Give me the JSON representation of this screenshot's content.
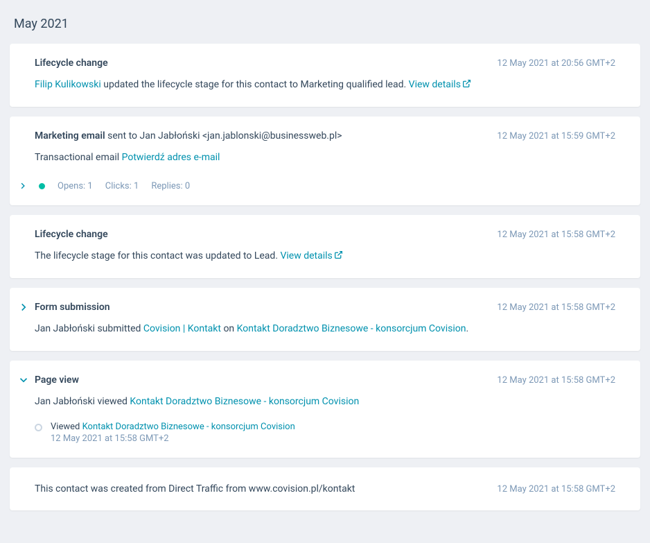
{
  "month_label": "May 2021",
  "cards": [
    {
      "title": "Lifecycle change",
      "timestamp": "12 May 2021 at 20:56 GMT+2",
      "actor": "Filip Kulikowski",
      "body_after_actor": " updated the lifecycle stage for this contact to Marketing qualified lead. ",
      "view_details": "View details"
    },
    {
      "title_strong": "Marketing email",
      "title_rest": " sent to Jan Jabłoński <jan.jablonski@businessweb.pl>",
      "timestamp": "12 May 2021 at 15:59 GMT+2",
      "body_prefix": "Transactional email ",
      "email_link": "Potwierdź adres e-mail",
      "opens_label": "Opens:",
      "opens_value": "1",
      "clicks_label": "Clicks:",
      "clicks_value": "1",
      "replies_label": "Replies:",
      "replies_value": "0"
    },
    {
      "title": "Lifecycle change",
      "timestamp": "12 May 2021 at 15:58 GMT+2",
      "body_text": "The lifecycle stage for this contact was updated to Lead. ",
      "view_details": "View details"
    },
    {
      "title": "Form submission",
      "timestamp": "12 May 2021 at 15:58 GMT+2",
      "body_prefix": "Jan Jabłoński submitted ",
      "form_link": "Covision | Kontakt",
      "body_mid": " on ",
      "page_link": "Kontakt Doradztwo Biznesowe - konsorcjum Covision",
      "body_suffix": "."
    },
    {
      "title": "Page view",
      "timestamp": "12 May 2021 at 15:58 GMT+2",
      "body_prefix": "Jan Jabłoński viewed ",
      "page_link": "Kontakt Doradztwo Biznesowe - konsorcjum Covision",
      "detail_viewed_label": "Viewed ",
      "detail_page_link": "Kontakt Doradztwo Biznesowe - konsorcjum Covision",
      "detail_timestamp": "12 May 2021 at 15:58 GMT+2"
    },
    {
      "body_text": "This contact was created from Direct Traffic from www.covision.pl/kontakt",
      "timestamp": "12 May 2021 at 15:58 GMT+2"
    }
  ]
}
